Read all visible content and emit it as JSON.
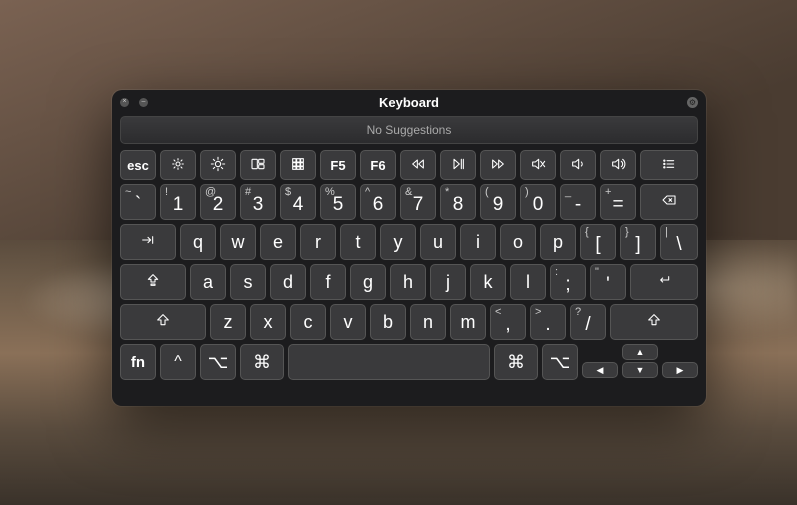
{
  "window": {
    "title": "Keyboard",
    "suggestion_text": "No Suggestions"
  },
  "function_row": {
    "esc": "esc",
    "f5": "F5",
    "f6": "F6"
  },
  "number_row": [
    {
      "upper": "~",
      "lower": "`"
    },
    {
      "upper": "!",
      "lower": "1"
    },
    {
      "upper": "@",
      "lower": "2"
    },
    {
      "upper": "#",
      "lower": "3"
    },
    {
      "upper": "$",
      "lower": "4"
    },
    {
      "upper": "%",
      "lower": "5"
    },
    {
      "upper": "^",
      "lower": "6"
    },
    {
      "upper": "&",
      "lower": "7"
    },
    {
      "upper": "*",
      "lower": "8"
    },
    {
      "upper": "(",
      "lower": "9"
    },
    {
      "upper": ")",
      "lower": "0"
    },
    {
      "upper": "_",
      "lower": "-"
    },
    {
      "upper": "+",
      "lower": "="
    }
  ],
  "qwerty_row": [
    "q",
    "w",
    "e",
    "r",
    "t",
    "y",
    "u",
    "i",
    "o",
    "p"
  ],
  "brackets": [
    {
      "upper": "{",
      "lower": "["
    },
    {
      "upper": "}",
      "lower": "]"
    },
    {
      "upper": "|",
      "lower": "\\"
    }
  ],
  "asdf_row": [
    "a",
    "s",
    "d",
    "f",
    "g",
    "h",
    "j",
    "k",
    "l"
  ],
  "punct2": [
    {
      "upper": ":",
      "lower": ";"
    },
    {
      "upper": "\"",
      "lower": "'"
    }
  ],
  "zxcv_row": [
    "z",
    "x",
    "c",
    "v",
    "b",
    "n",
    "m"
  ],
  "punct3": [
    {
      "upper": "<",
      "lower": ","
    },
    {
      "upper": ">",
      "lower": "."
    },
    {
      "upper": "?",
      "lower": "/"
    }
  ],
  "bottom": {
    "fn": "fn",
    "cmd": "⌘",
    "opt": "⌥",
    "ctrl": "^"
  },
  "arrows": {
    "up": "▲",
    "down": "▼",
    "left": "◀",
    "right": "▶"
  }
}
